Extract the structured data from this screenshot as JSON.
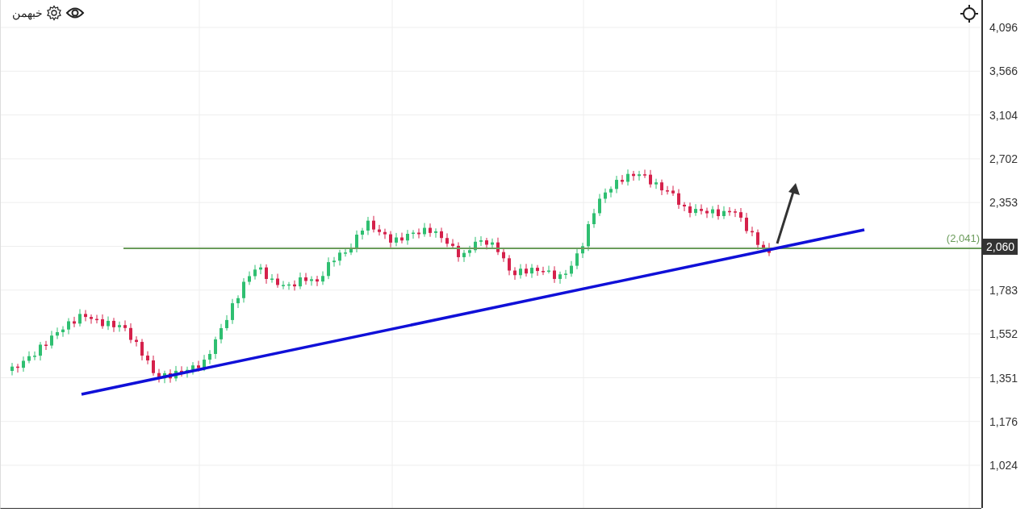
{
  "toolbar": {
    "symbol": "خبهمن"
  },
  "price_axis": {
    "labels": [
      {
        "text": "4,096",
        "highlighted": false
      },
      {
        "text": "3,566",
        "highlighted": false
      },
      {
        "text": "3,104",
        "highlighted": false
      },
      {
        "text": "2,702",
        "highlighted": false
      },
      {
        "text": "2,353",
        "highlighted": false
      },
      {
        "text": "2,060",
        "highlighted": true
      },
      {
        "text": "1,783",
        "highlighted": false
      },
      {
        "text": "1,552",
        "highlighted": false
      },
      {
        "text": "1,351",
        "highlighted": false
      },
      {
        "text": "1,176",
        "highlighted": false
      },
      {
        "text": "1,024",
        "highlighted": false
      }
    ]
  },
  "horizontal_level": {
    "label": "(2,041)"
  }
}
